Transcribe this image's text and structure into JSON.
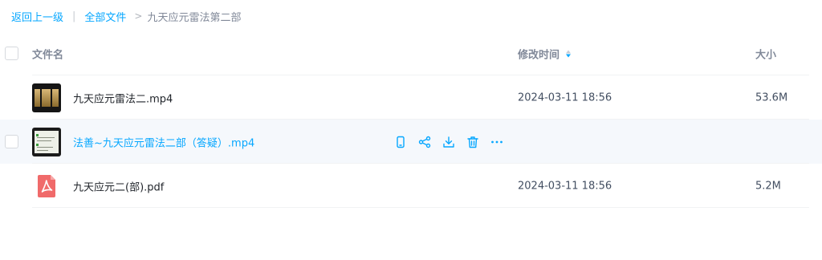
{
  "breadcrumb": {
    "back": "返回上一级",
    "root": "全部文件",
    "separator_gt": ">",
    "current": "九天应元雷法第二部"
  },
  "columns": {
    "name": "文件名",
    "time": "修改时间",
    "size": "大小"
  },
  "sort": {
    "column": "time",
    "icon": "sort-desc-icon"
  },
  "accent_color": "#06a7ff",
  "files": [
    {
      "name": "九天应元雷法二.mp4",
      "modified": "2024-03-11 18:56",
      "size": "53.6M",
      "icon": "video-thumbnail"
    },
    {
      "name": "法善~九天应元雷法二部（答疑）.mp4",
      "modified": "",
      "size": "",
      "icon": "video-thumbnail",
      "hovered": true
    },
    {
      "name": "九天应元二(部).pdf",
      "modified": "2024-03-11 18:56",
      "size": "5.2M",
      "icon": "pdf-icon"
    }
  ],
  "row_actions": [
    "phone-icon",
    "share-icon",
    "download-icon",
    "delete-icon",
    "more-icon"
  ]
}
